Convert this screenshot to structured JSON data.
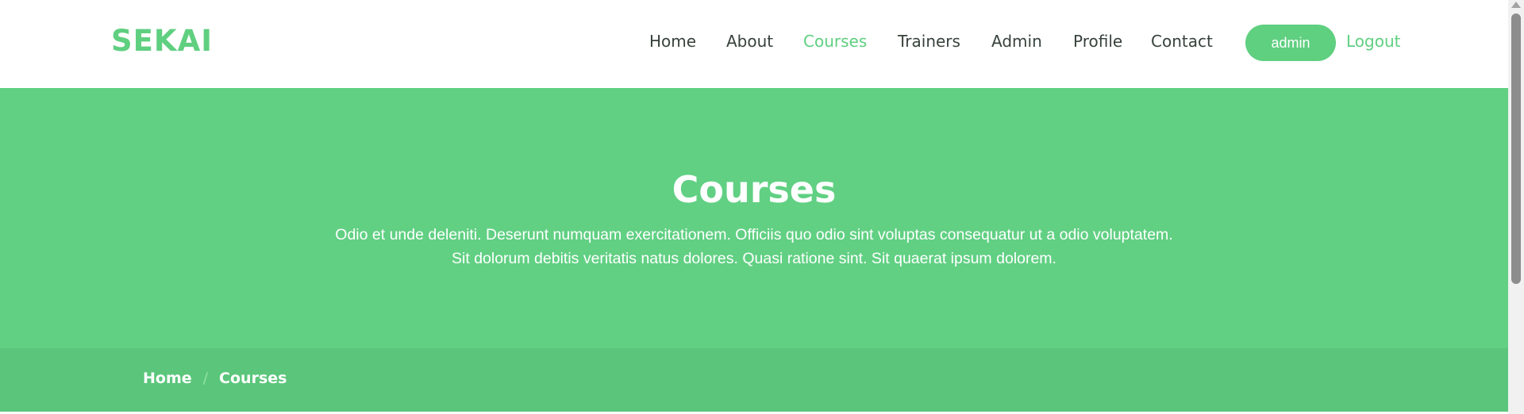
{
  "brand": {
    "logo": "SEKAI",
    "accent": "#5fcf80"
  },
  "nav": {
    "items": [
      {
        "label": "Home"
      },
      {
        "label": "About"
      },
      {
        "label": "Courses",
        "active": true
      },
      {
        "label": "Trainers"
      },
      {
        "label": "Admin"
      },
      {
        "label": "Profile"
      },
      {
        "label": "Contact"
      }
    ],
    "user_button": "admin",
    "logout": "Logout"
  },
  "hero": {
    "title": "Courses",
    "text": "Odio et unde deleniti. Deserunt numquam exercitationem. Officiis quo odio sint voluptas consequatur ut a odio voluptatem. Sit dolorum debitis veritatis natus dolores. Quasi ratione sint. Sit quaerat ipsum dolorem.",
    "background": "#61d083"
  },
  "breadcrumb": {
    "items": [
      "Home",
      "Courses"
    ],
    "separator": "/"
  }
}
